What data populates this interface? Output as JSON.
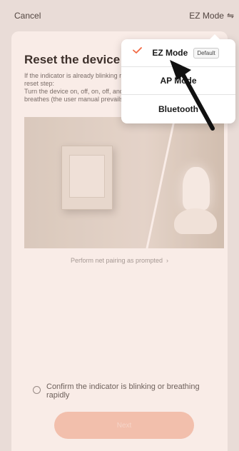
{
  "topbar": {
    "cancel_label": "Cancel",
    "mode_label": "EZ Mode",
    "swap_icon": "swap-arrows-icon"
  },
  "card": {
    "title": "Reset the device first",
    "desc_lines": [
      "If the indicator is already blinking rapidly,",
      "reset step:",
      "Turn the device on, off, on, off, and on",
      "breathes (the user manual prevails)"
    ],
    "perform_link": "Perform net pairing as prompted",
    "confirm_text": "Confirm the indicator is blinking or breathing rapidly",
    "next_label": "Next"
  },
  "popup": {
    "items": [
      {
        "label": "EZ Mode",
        "badge": "Default",
        "selected": true
      },
      {
        "label": "AP Mode",
        "selected": false
      },
      {
        "label": "Bluetooth",
        "selected": false
      }
    ]
  },
  "colors": {
    "accent": "#f26a43",
    "next_button": "#f7c8b8",
    "overlay": "#dc9678"
  }
}
